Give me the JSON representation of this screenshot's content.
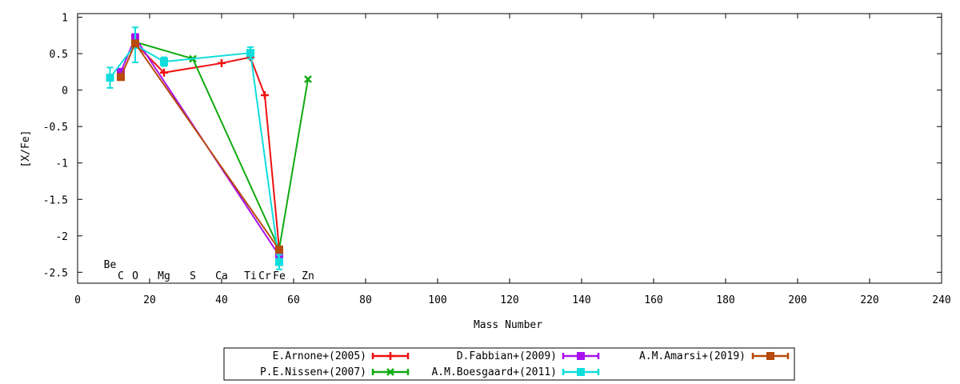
{
  "chart_data": {
    "type": "line",
    "title": "",
    "xlabel": "Mass Number",
    "ylabel": "[X/Fe]",
    "xlim": [
      0,
      240
    ],
    "ylim": [
      -2.65,
      1.05
    ],
    "xticks": [
      0,
      20,
      40,
      60,
      80,
      100,
      120,
      140,
      160,
      180,
      200,
      220,
      240
    ],
    "yticks": [
      1,
      0.5,
      0,
      -0.5,
      -1,
      -1.5,
      -2,
      -2.5
    ],
    "ytick_labels": [
      "1",
      "0.5",
      "0",
      "-0.5",
      "-1",
      "-1.5",
      "-2",
      "-2.5"
    ],
    "grid": false,
    "legend_position": "bottom-center",
    "element_labels": [
      {
        "text": "Be",
        "x": 9,
        "row": "upper"
      },
      {
        "text": "C",
        "x": 12,
        "row": "lower"
      },
      {
        "text": "O",
        "x": 16,
        "row": "lower"
      },
      {
        "text": "Mg",
        "x": 24,
        "row": "lower"
      },
      {
        "text": "S",
        "x": 32,
        "row": "lower"
      },
      {
        "text": "Ca",
        "x": 40,
        "row": "lower"
      },
      {
        "text": "Ti",
        "x": 48,
        "row": "lower"
      },
      {
        "text": "Cr",
        "x": 52,
        "row": "lower"
      },
      {
        "text": "Fe",
        "x": 56,
        "row": "lower"
      },
      {
        "text": "Zn",
        "x": 64,
        "row": "lower"
      }
    ],
    "series": [
      {
        "name": "E.Arnone+(2005)",
        "color": "#ee1111",
        "marker": "plus",
        "points": [
          [
            16,
            0.64,
            0
          ],
          [
            24,
            0.24,
            0
          ],
          [
            40,
            0.37,
            0
          ],
          [
            48,
            0.45,
            0
          ],
          [
            52,
            -0.07,
            0
          ],
          [
            56,
            -2.18,
            0
          ]
        ]
      },
      {
        "name": "P.E.Nissen+(2007)",
        "color": "#11aa11",
        "marker": "x",
        "points": [
          [
            16,
            0.66,
            0
          ],
          [
            32,
            0.43,
            0
          ],
          [
            56,
            -2.18,
            0
          ],
          [
            64,
            0.15,
            0
          ]
        ]
      },
      {
        "name": "D.Fabbian+(2009)",
        "color": "#aa11ee",
        "marker": "square",
        "points": [
          [
            12,
            0.25,
            0
          ],
          [
            16,
            0.72,
            0.05
          ],
          [
            56,
            -2.27,
            0
          ]
        ]
      },
      {
        "name": "A.M.Boesgaard+(2011)",
        "color": "#11dddd",
        "marker": "square",
        "points": [
          [
            9,
            0.17,
            0.14
          ],
          [
            16,
            0.62,
            0.24
          ],
          [
            24,
            0.39,
            0.06
          ],
          [
            48,
            0.51,
            0.08
          ],
          [
            56,
            -2.36,
            0.1
          ]
        ]
      },
      {
        "name": "A.M.Amarsi+(2019)",
        "color": "#b84a0b",
        "marker": "square",
        "points": [
          [
            12,
            0.18,
            0
          ],
          [
            16,
            0.64,
            0
          ],
          [
            56,
            -2.19,
            0
          ]
        ]
      }
    ]
  }
}
